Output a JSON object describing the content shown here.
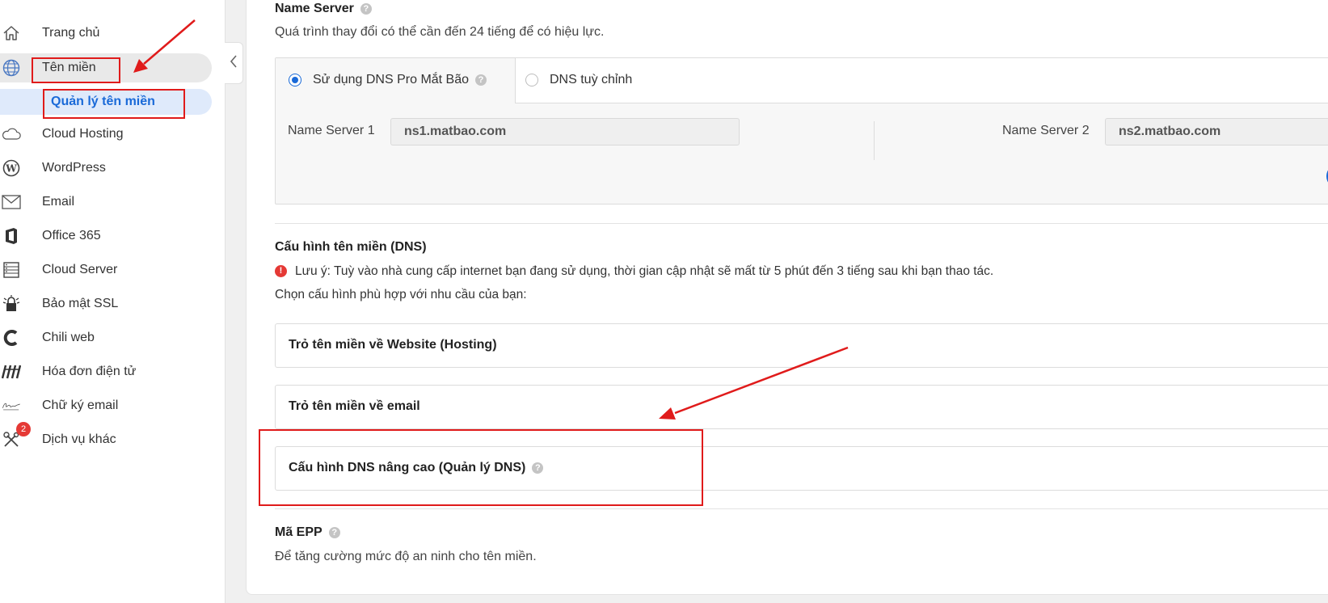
{
  "sidebar": {
    "items": [
      {
        "label": "Trang chủ",
        "icon": "home-icon"
      },
      {
        "label": "Tên miền",
        "icon": "globe-icon"
      },
      {
        "label": "Cloud Hosting",
        "icon": "cloud-icon"
      },
      {
        "label": "WordPress",
        "icon": "wordpress-icon"
      },
      {
        "label": "Email",
        "icon": "envelope-icon"
      },
      {
        "label": "Office 365",
        "icon": "office-icon"
      },
      {
        "label": "Cloud Server",
        "icon": "server-icon"
      },
      {
        "label": "Bảo mật SSL",
        "icon": "ssl-lock-icon"
      },
      {
        "label": "Chili web",
        "icon": "chili-icon"
      },
      {
        "label": "Hóa đơn điện tử",
        "icon": "invoice-icon"
      },
      {
        "label": "Chữ ký email",
        "icon": "signature-icon"
      },
      {
        "label": "Dịch vụ khác",
        "icon": "tools-icon",
        "badge": "2"
      }
    ],
    "sub_item": {
      "label": "Quản lý tên miền"
    }
  },
  "name_server": {
    "title": "Name Server",
    "description": "Quá trình thay đổi có thể cần đến 24 tiếng để có hiệu lực.",
    "tab_pro": "Sử dụng DNS Pro Mắt Bão",
    "tab_custom": "DNS tuỳ chỉnh",
    "ns1_label": "Name Server 1",
    "ns1_value": "ns1.matbao.com",
    "ns2_label": "Name Server 2",
    "ns2_value": "ns2.matbao.com"
  },
  "dns_config": {
    "title": "Cấu hình tên miền (DNS)",
    "note": "Lưu ý: Tuỳ vào nhà cung cấp internet bạn đang sử dụng, thời gian cập nhật sẽ mất từ 5 phút đến 3 tiếng sau khi bạn thao tác.",
    "choose": "Chọn cấu hình phù hợp với nhu cầu của bạn:",
    "options": [
      "Trỏ tên miền về Website (Hosting)",
      "Trỏ tên miền về email",
      "Cấu hình DNS nâng cao (Quản lý DNS)"
    ]
  },
  "epp": {
    "title": "Mã EPP",
    "description": "Để tăng cường mức độ an ninh cho tên miền."
  },
  "colors": {
    "accent": "#1a6ad8",
    "highlight_red": "#e01b1b",
    "badge_red": "#e53935"
  }
}
